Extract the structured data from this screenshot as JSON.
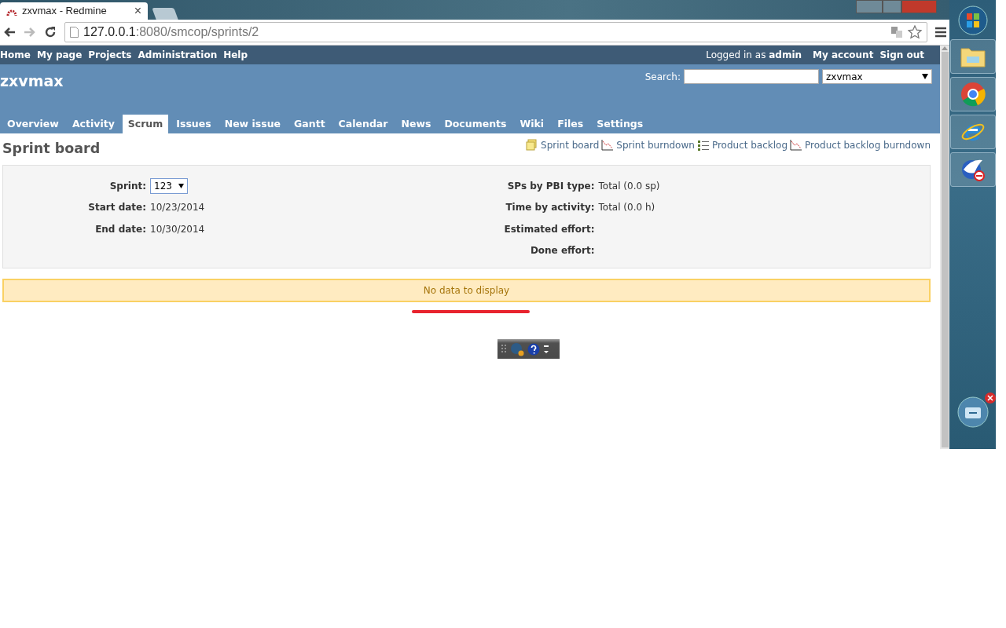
{
  "browser": {
    "tab_title": "zxvmax - Redmine",
    "tab_close": "×",
    "url_host": "127.0.0.1",
    "url_path": ":8080/smcop/sprints/2"
  },
  "top_menu": {
    "items": [
      "Home",
      "My page",
      "Projects",
      "Administration",
      "Help"
    ],
    "logged_in_prefix": "Logged in as",
    "user": "admin",
    "account_items": [
      "My account",
      "Sign out"
    ]
  },
  "header": {
    "project": "zxvmax",
    "search_label": "Search:",
    "project_select": "zxvmax"
  },
  "tabs": [
    {
      "label": "Overview",
      "selected": false
    },
    {
      "label": "Activity",
      "selected": false
    },
    {
      "label": "Scrum",
      "selected": true
    },
    {
      "label": "Issues",
      "selected": false
    },
    {
      "label": "New issue",
      "selected": false
    },
    {
      "label": "Gantt",
      "selected": false
    },
    {
      "label": "Calendar",
      "selected": false
    },
    {
      "label": "News",
      "selected": false
    },
    {
      "label": "Documents",
      "selected": false
    },
    {
      "label": "Wiki",
      "selected": false
    },
    {
      "label": "Files",
      "selected": false
    },
    {
      "label": "Settings",
      "selected": false
    }
  ],
  "page": {
    "title": "Sprint board",
    "links": [
      {
        "label": "Sprint board",
        "kind": "board"
      },
      {
        "label": "Sprint burndown",
        "kind": "chart"
      },
      {
        "label": "Product backlog",
        "kind": "list"
      },
      {
        "label": "Product backlog burndown",
        "kind": "chart"
      }
    ]
  },
  "sprint_info": {
    "left": [
      {
        "label": "Sprint:",
        "kind": "select",
        "value": "123"
      },
      {
        "label": "Start date:",
        "kind": "text",
        "value": "10/23/2014"
      },
      {
        "label": "End date:",
        "kind": "text",
        "value": "10/30/2014"
      }
    ],
    "right": [
      {
        "label": "SPs by PBI type:",
        "value": "Total (0.0 sp)"
      },
      {
        "label": "Time by activity:",
        "value": "Total (0.0 h)"
      },
      {
        "label": "Estimated effort:"
      },
      {
        "label": "Done effort:"
      }
    ]
  },
  "notice": "No data to display"
}
